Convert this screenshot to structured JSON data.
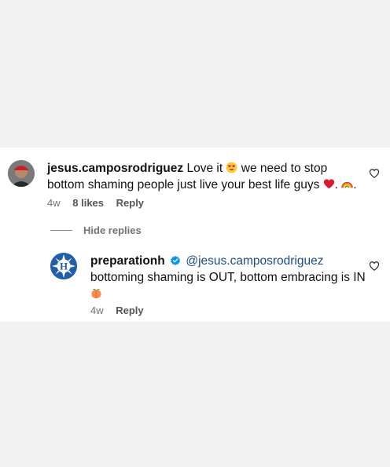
{
  "main_comment": {
    "username": "jesus.camposrodriguez",
    "text_part1": "Love it",
    "text_part2": "we need to stop bottom shaming people just live your best life guys",
    "text_part3": ".",
    "text_part4": ".",
    "time": "4w",
    "likes": "8 likes",
    "reply_label": "Reply"
  },
  "toggle": {
    "hide_replies": "Hide replies"
  },
  "reply": {
    "username": "preparationh",
    "mention": "@jesus.camposrodriguez",
    "text": "bottoming shaming is OUT, bottom embracing is IN",
    "time": "4w",
    "reply_label": "Reply"
  },
  "brand": {
    "logo_letter": "H"
  },
  "icons": {
    "like": "heart-outline-icon",
    "verified": "verified-badge-icon",
    "emojis": [
      "smiling-face-with-heart-eyes",
      "red-heart",
      "rainbow",
      "peach"
    ]
  },
  "colors": {
    "mention": "#1c4a8a",
    "verified": "#0095f6",
    "brand_blue": "#1f5ea8"
  }
}
